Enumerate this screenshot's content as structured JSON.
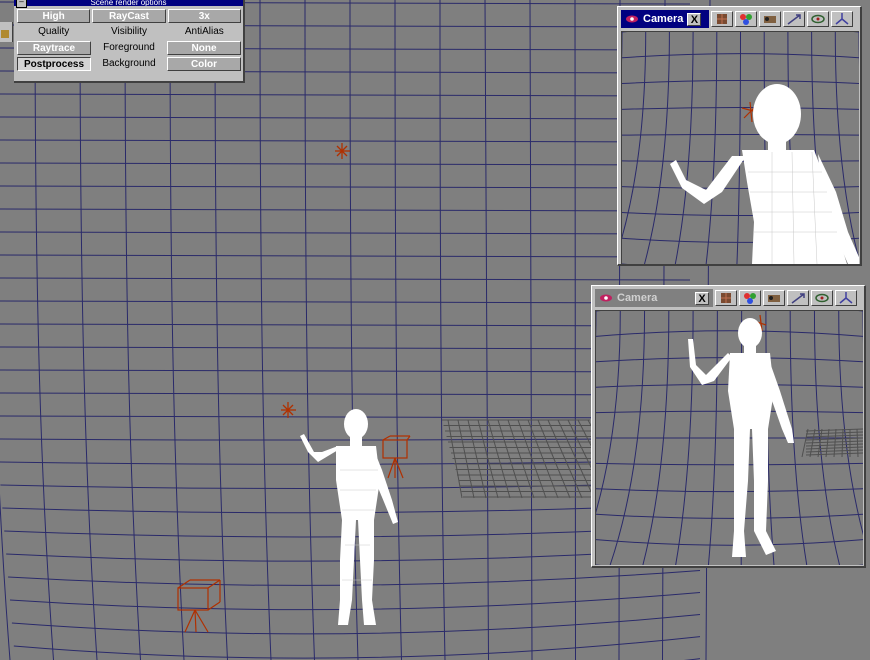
{
  "render_options": {
    "title": "Scene render options",
    "close_label": "–",
    "rows": [
      [
        {
          "label": "High",
          "style": "raised"
        },
        {
          "label": "RayCast",
          "style": "raised"
        },
        {
          "label": "3x",
          "style": "raised"
        }
      ],
      [
        {
          "label": "Quality",
          "style": "flat"
        },
        {
          "label": "Visibility",
          "style": "flat"
        },
        {
          "label": "AntiAlias",
          "style": "flat"
        }
      ],
      [
        {
          "label": "Raytrace",
          "style": "raised"
        },
        {
          "label": "Foreground",
          "style": "flat"
        },
        {
          "label": "None",
          "style": "raised"
        }
      ],
      [
        {
          "label": "Postprocess",
          "style": "sunken"
        },
        {
          "label": "Background",
          "style": "flat"
        },
        {
          "label": "Color",
          "style": "raised"
        }
      ]
    ]
  },
  "camera_windows": [
    {
      "title": "Camera",
      "state": "active",
      "close_label": "X"
    },
    {
      "title": "Camera",
      "state": "inactive",
      "close_label": "X"
    }
  ],
  "toolbar_icons": [
    "texture-icon",
    "palette-icon",
    "reel-icon",
    "pan-icon",
    "orbit-icon",
    "axis-icon"
  ],
  "colors": {
    "background": "#7f7f7f",
    "grid": "#2a2a6a",
    "camera_gizmo": "#b03000",
    "figure": "#ffffff",
    "title_active": "#000080",
    "title_inactive": "#808080"
  }
}
